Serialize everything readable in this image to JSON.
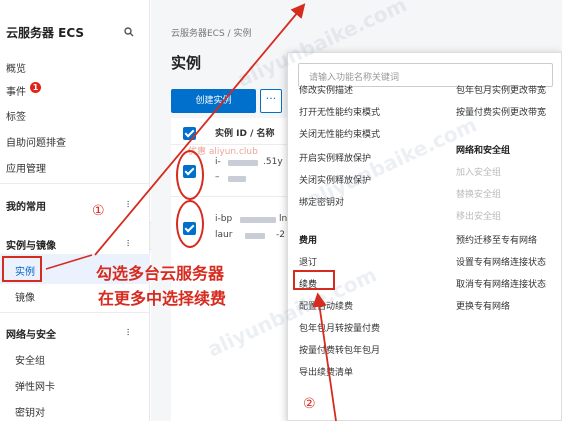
{
  "sidebar": {
    "title": "云服务器 ECS",
    "items": [
      "概览",
      "事件",
      "标签",
      "自助问题排查",
      "应用管理"
    ],
    "event_badge": "1",
    "sections": {
      "favorites": "我的常用",
      "instances_images": "实例与镜像",
      "network_security": "网络与安全"
    },
    "instances_images_items": [
      "实例",
      "镜像"
    ],
    "network_security_items": [
      "安全组",
      "弹性网卡",
      "密钥对"
    ]
  },
  "main": {
    "breadcrumb": "云服务器ECS / 实例",
    "page_title": "实例",
    "create_button": "创建实例",
    "more_button": "···",
    "column_header": "实例 ID / 名称",
    "row1_id": "i-",
    "row1_tail": ".51y",
    "row1_name": "–",
    "row2_id": "i-bp",
    "row2_tail": "lnc",
    "row2_name": "laur",
    "row2_name_tail": "-2"
  },
  "dropdown": {
    "search_placeholder": "请输入功能名称关键词",
    "left_items": [
      "修改实例描述",
      "打开无性能约束模式",
      "关闭无性能约束模式",
      "开启实例释放保护",
      "关闭实例释放保护",
      "绑定密钥对",
      "费用",
      "退订",
      "续费",
      "配置自动续费",
      "包年包月转按量付费",
      "按量付费转包年包月",
      "导出续费清单"
    ],
    "right_items": [
      "包年包月实例更改带宽",
      "按量付费实例更改带宽"
    ],
    "right_heading": "网络和安全组",
    "right_disabled": [
      "加入安全组",
      "替换安全组",
      "移出安全组"
    ],
    "right_bottom": [
      "预约迁移至专有网络",
      "设置专有网络连接状态",
      "取消专有网络连接状态",
      "更换专有网络"
    ]
  },
  "annotations": {
    "step1": "①",
    "step2": "②",
    "instruction_line1": "勾选多台云服务器",
    "instruction_line2": "在更多中选择续费",
    "watermark_small": "优惠 aliyun.club",
    "color": "#d62b1f"
  }
}
